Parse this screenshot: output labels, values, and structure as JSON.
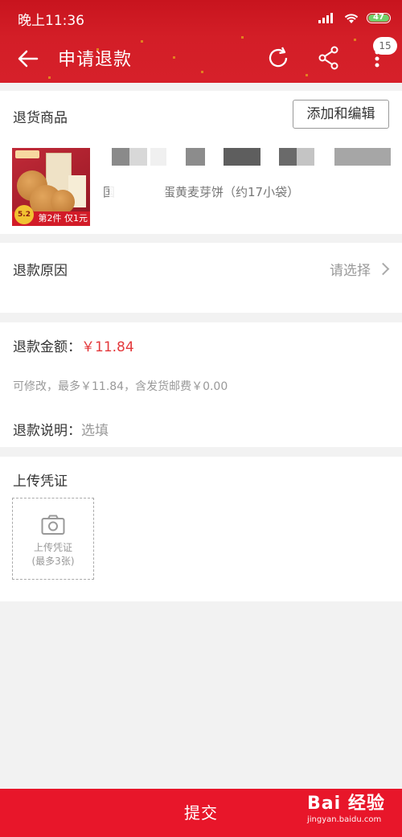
{
  "status_bar": {
    "time": "晚上11:36",
    "battery": "47"
  },
  "header": {
    "title": "申请退款",
    "badge_count": "15"
  },
  "goods": {
    "section_title": "退货商品",
    "edit_button": "添加和编辑",
    "product_name": "国　　　　蛋黄麦芽饼（约17小袋）",
    "thumbnail_banner": "第2件 仅1元",
    "thumbnail_tag": "5.2"
  },
  "reason": {
    "label": "退款原因",
    "placeholder": "请选择"
  },
  "amount": {
    "label": "退款金额：",
    "value": "￥11.84",
    "hint": "可修改，最多￥11.84，含发货邮费￥0.00",
    "note_label": "退款说明：",
    "note_placeholder": "选填"
  },
  "upload": {
    "section_title": "上传凭证",
    "box_line1": "上传凭证",
    "box_line2": "(最多3张)"
  },
  "footer": {
    "submit_label": "提交",
    "watermark_brand": "Bai 经验",
    "watermark_url": "jingyan.baidu.com"
  },
  "colors": {
    "header_red": "#d31e27",
    "price_red": "#e4393c",
    "submit_red": "#e8162a"
  }
}
